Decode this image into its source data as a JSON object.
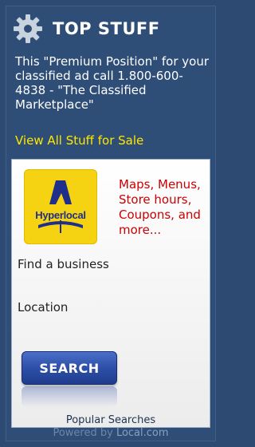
{
  "header": {
    "title": "TOP STUFF",
    "icon": "gear-icon"
  },
  "promo": {
    "text": "This \"Premium Position\" for your classified ad call 1.800-600-4838 - \"The Classified Marketplace\""
  },
  "links": {
    "view_all": "View All Stuff for Sale"
  },
  "widget": {
    "logo_text": "Hyperlocal",
    "tagline": "Maps, Menus, Store hours, Coupons, and more...",
    "find_label": "Find a business",
    "location_label": "Location",
    "search_label": "SEARCH"
  },
  "footer": {
    "popular": "Popular Searches",
    "powered_prefix": "Powered by ",
    "powered_brand": "Local.com"
  },
  "colors": {
    "background": "#2c4a72",
    "link": "#ffe800",
    "tagline": "#cc0000",
    "button": "#2e4fa8"
  }
}
